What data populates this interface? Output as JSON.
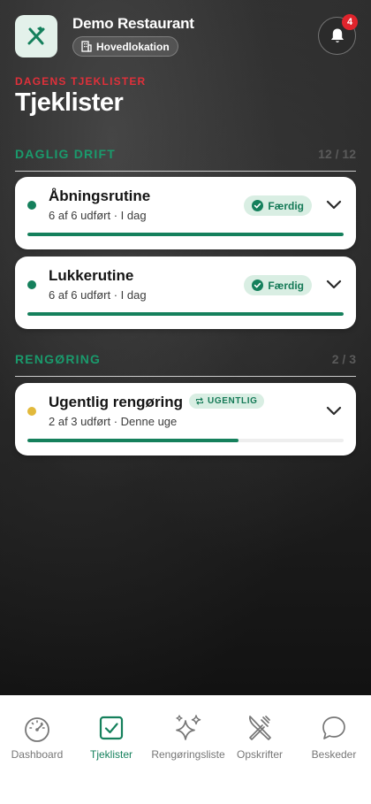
{
  "header": {
    "restaurant_name": "Demo Restaurant",
    "location": "Hovedlokation",
    "notification_count": "4",
    "logo_icon": "fork-knife-icon"
  },
  "page": {
    "eyebrow": "DAGENS TJEKLISTER",
    "title": "Tjeklister"
  },
  "sections": [
    {
      "title": "DAGLIG DRIFT",
      "count": "12 / 12",
      "items": [
        {
          "title": "Åbningsrutine",
          "subtitle": "6 af 6 udført · I dag",
          "status": "Færdig",
          "progress": 1.0,
          "dot_color": "#15805c"
        },
        {
          "title": "Lukkerutine",
          "subtitle": "6 af 6 udført · I dag",
          "status": "Færdig",
          "progress": 1.0,
          "dot_color": "#15805c"
        }
      ]
    },
    {
      "title": "RENGØRING",
      "count": "2 / 3",
      "items": [
        {
          "title": "Ugentlig rengøring",
          "tag": "UGENTLIG",
          "subtitle": "2 af 3 udført · Denne uge",
          "progress": 0.667,
          "dot_color": "#e2b93b"
        }
      ]
    }
  ],
  "tabbar": {
    "tabs": [
      {
        "label": "Dashboard",
        "icon": "gauge-icon"
      },
      {
        "label": "Tjeklister",
        "icon": "checkbox-icon",
        "active": true
      },
      {
        "label": "Rengøringsliste",
        "icon": "sparkles-icon"
      },
      {
        "label": "Opskrifter",
        "icon": "fork-knife-icon"
      },
      {
        "label": "Beskeder",
        "icon": "chat-bubble-icon"
      }
    ]
  },
  "colors": {
    "accent": "#15805c",
    "alert": "#e0242c",
    "pending": "#e2b93b"
  }
}
